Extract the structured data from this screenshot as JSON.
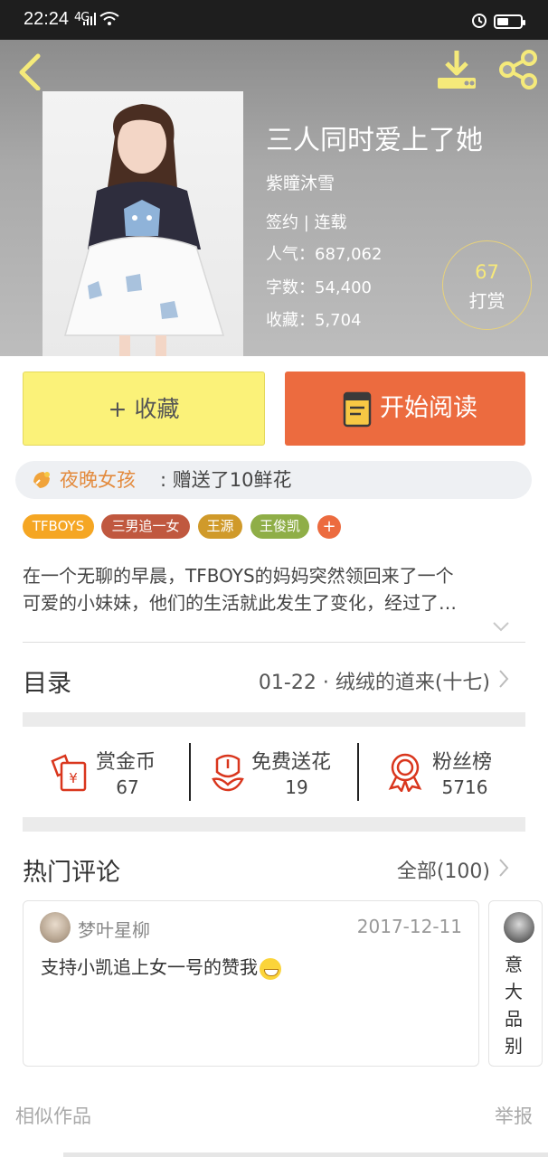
{
  "status_bar": {
    "time": "22:24",
    "signal": "4G"
  },
  "book": {
    "title": "三人同时爱上了她",
    "author": "紫瞳沐雪",
    "status": "签约 | 连载",
    "popularity": "人气：687,062",
    "word_count": "字数：54,400",
    "collections": "收藏：5,704",
    "tip_count": "67",
    "tip_label": "打赏"
  },
  "actions": {
    "favorite": "+ 收藏",
    "read": "开始阅读"
  },
  "gift": {
    "user": "夜晚女孩",
    "text": ": 赠送了10鲜花"
  },
  "tags": [
    {
      "label": "TFBOYS",
      "color": "#f5a623"
    },
    {
      "label": "三男追一女",
      "color": "#c0583f"
    },
    {
      "label": "王源",
      "color": "#d09a2a"
    },
    {
      "label": "王俊凯",
      "color": "#8fae47"
    }
  ],
  "tag_add": "+",
  "description": {
    "line1": "在一个无聊的早晨，TFBOYS的妈妈突然领回来了一个",
    "line2": "可爱的小妹妹，他们的生活就此发生了变化，经过了…"
  },
  "catalog": {
    "title": "目录",
    "latest": "01-22 · 绒绒的道来(十七)"
  },
  "stats": [
    {
      "label": "赏金币",
      "value": "67"
    },
    {
      "label": "免费送花",
      "value": "19"
    },
    {
      "label": "粉丝榜",
      "value": "5716"
    }
  ],
  "comments": {
    "title": "热门评论",
    "all": "全部(100)",
    "items": [
      {
        "user": "梦叶星柳",
        "date": "2017-12-11",
        "text": "支持小凯追上女一号的赞我"
      }
    ],
    "next_preview": [
      "意",
      "大",
      "品",
      "别"
    ]
  },
  "footer": {
    "similar": "相似作品",
    "report": "举报"
  },
  "colors": {
    "accent_orange": "#ec6b3f",
    "fav_yellow": "#fbf279",
    "icon_yellow": "#f5ea7a",
    "stat_red": "#d9361d"
  },
  "icons": [
    "back-icon",
    "download-icon",
    "share-icon",
    "book-icon",
    "gift-icon",
    "red-envelope-icon",
    "flower-icon",
    "medal-icon",
    "chevron-right-icon",
    "chevron-down-icon"
  ]
}
